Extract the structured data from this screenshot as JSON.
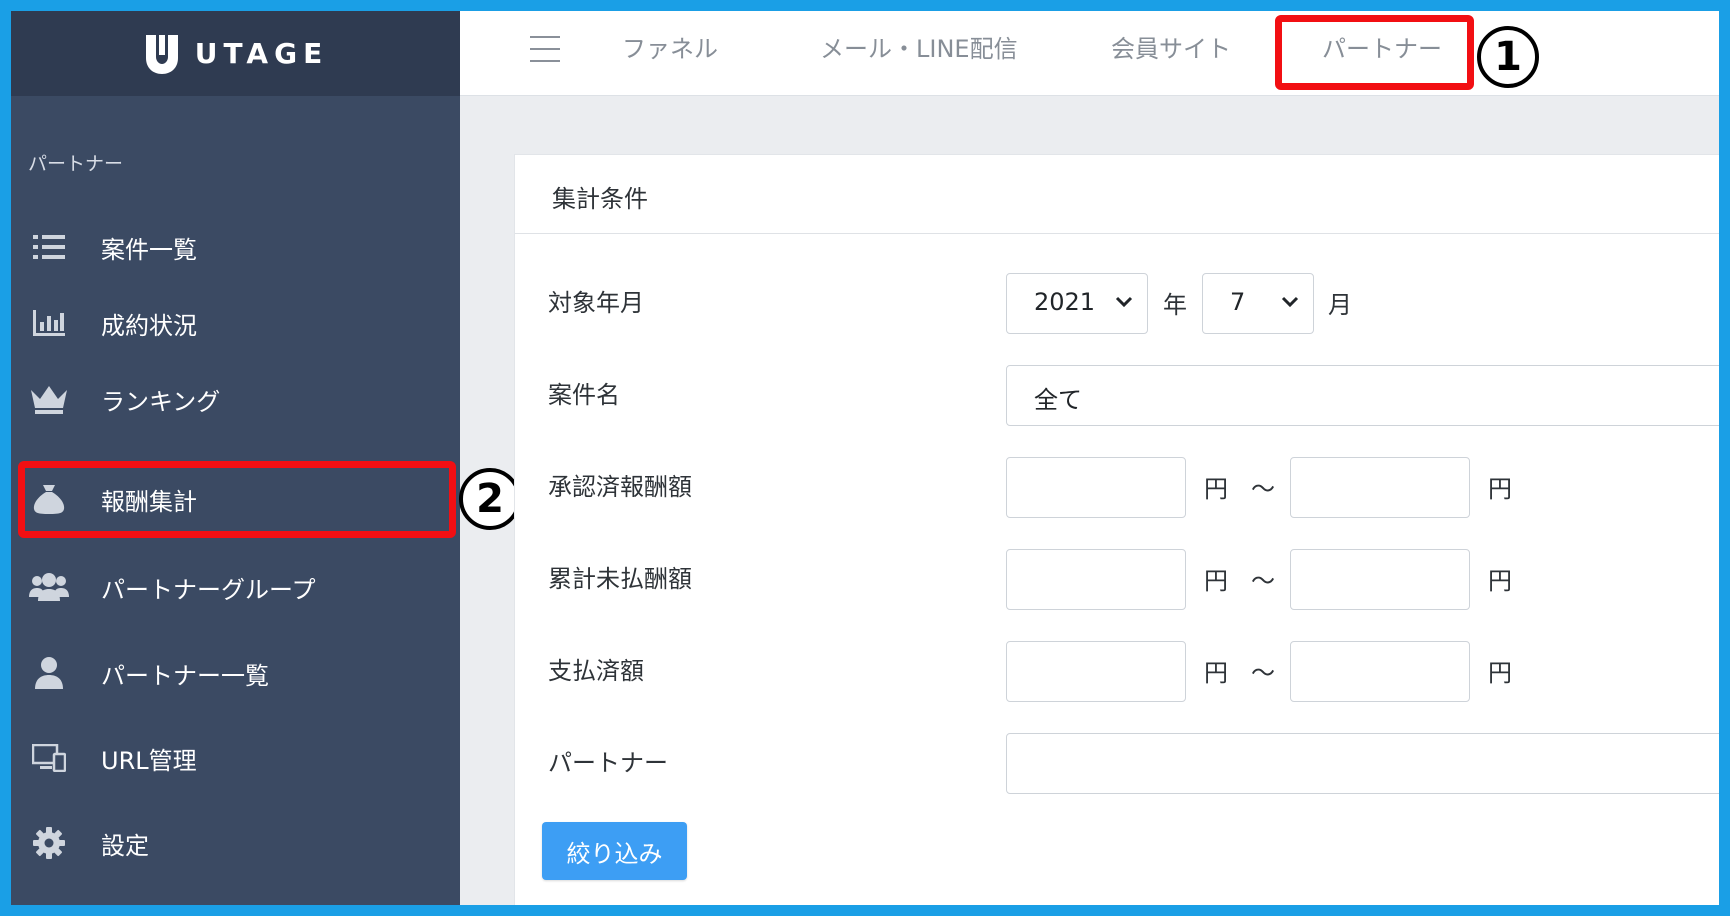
{
  "brand": {
    "name": "UTAGE"
  },
  "topnav": {
    "tabs": [
      {
        "label": "ファネル"
      },
      {
        "label": "メール・LINE配信"
      },
      {
        "label": "会員サイト"
      },
      {
        "label": "パートナー"
      }
    ]
  },
  "sidebar": {
    "section_label": "パートナー",
    "items": [
      {
        "label": "案件一覧",
        "icon": "list-icon"
      },
      {
        "label": "成約状況",
        "icon": "bar-chart-icon"
      },
      {
        "label": "ランキング",
        "icon": "crown-icon"
      },
      {
        "label": "報酬集計",
        "icon": "money-bag-icon"
      },
      {
        "label": "パートナーグループ",
        "icon": "users-icon"
      },
      {
        "label": "パートナー一覧",
        "icon": "user-icon"
      },
      {
        "label": "URL管理",
        "icon": "display-icon"
      },
      {
        "label": "設定",
        "icon": "gear-icon"
      }
    ]
  },
  "annotations": {
    "one": "1",
    "two": "2"
  },
  "card": {
    "title": "集計条件",
    "period_label": "対象年月",
    "year_value": "2021",
    "year_unit": "年",
    "month_value": "7",
    "month_unit": "月",
    "project_label": "案件名",
    "project_value": "全て",
    "approved_label": "承認済報酬額",
    "unpaid_label": "累計未払酬額",
    "paid_label": "支払済額",
    "yen": "円",
    "tilde": "〜",
    "partner_label": "パートナー",
    "filter_button": "絞り込み"
  },
  "colors": {
    "frame_border": "#1a9fe6",
    "sidebar_bg": "#3b4a63",
    "logo_bar_bg": "#2f3b51",
    "highlight": "#f20f13",
    "button_bg": "#3d9ef4"
  }
}
